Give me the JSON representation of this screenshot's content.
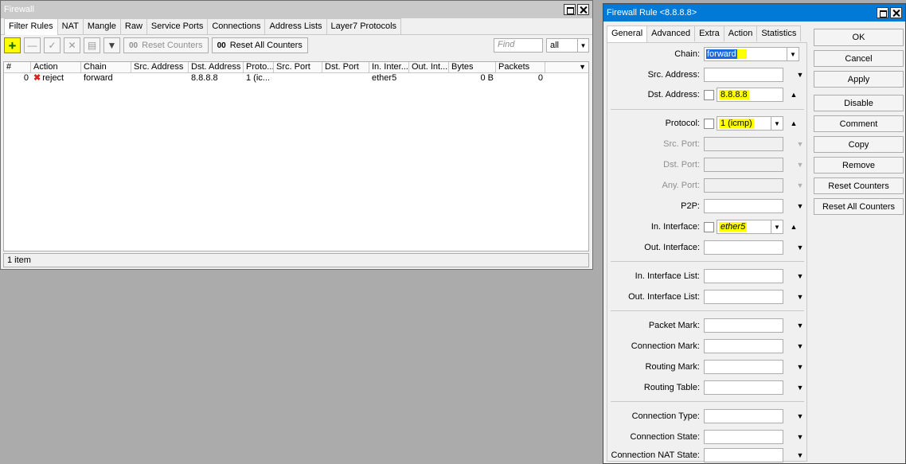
{
  "firewall": {
    "title": "Firewall",
    "tabs": [
      "Filter Rules",
      "NAT",
      "Mangle",
      "Raw",
      "Service Ports",
      "Connections",
      "Address Lists",
      "Layer7 Protocols"
    ],
    "toolbar": {
      "reset_counters": "Reset Counters",
      "reset_all_counters": "Reset All Counters",
      "counter_glyph": "00",
      "find_placeholder": "Find",
      "filter_value": "all"
    },
    "columns": [
      "#",
      "Action",
      "Chain",
      "Src. Address",
      "Dst. Address",
      "Proto...",
      "Src. Port",
      "Dst. Port",
      "In. Inter...",
      "Out. Int...",
      "Bytes",
      "Packets"
    ],
    "rows": [
      {
        "num": "0",
        "action": "reject",
        "chain": "forward",
        "src_address": "",
        "dst_address": "8.8.8.8",
        "protocol": "1 (ic...",
        "src_port": "",
        "dst_port": "",
        "in_interface": "ether5",
        "out_interface": "",
        "bytes": "0 B",
        "packets": "0"
      }
    ],
    "status": "1 item"
  },
  "rule": {
    "title": "Firewall Rule <8.8.8.8>",
    "tabs": [
      "General",
      "Advanced",
      "Extra",
      "Action",
      "Statistics"
    ],
    "fields": {
      "chain": {
        "label": "Chain:",
        "value": "forward"
      },
      "src_address": {
        "label": "Src. Address:"
      },
      "dst_address": {
        "label": "Dst. Address:",
        "value": "8.8.8.8"
      },
      "protocol": {
        "label": "Protocol:",
        "value": "1 (icmp)"
      },
      "src_port": {
        "label": "Src. Port:"
      },
      "dst_port": {
        "label": "Dst. Port:"
      },
      "any_port": {
        "label": "Any. Port:"
      },
      "p2p": {
        "label": "P2P:"
      },
      "in_interface": {
        "label": "In. Interface:",
        "value": "ether5"
      },
      "out_interface": {
        "label": "Out. Interface:"
      },
      "in_interface_list": {
        "label": "In. Interface List:"
      },
      "out_interface_list": {
        "label": "Out. Interface List:"
      },
      "packet_mark": {
        "label": "Packet Mark:"
      },
      "connection_mark": {
        "label": "Connection Mark:"
      },
      "routing_mark": {
        "label": "Routing Mark:"
      },
      "routing_table": {
        "label": "Routing Table:"
      },
      "connection_type": {
        "label": "Connection Type:"
      },
      "connection_state": {
        "label": "Connection State:"
      },
      "connection_nat_state": {
        "label": "Connection NAT State:"
      }
    },
    "buttons": {
      "ok": "OK",
      "cancel": "Cancel",
      "apply": "Apply",
      "disable": "Disable",
      "comment": "Comment",
      "copy": "Copy",
      "remove": "Remove",
      "reset_counters": "Reset Counters",
      "reset_all_counters": "Reset All Counters"
    }
  },
  "colors": {
    "highlight": "#ffff00",
    "titlebar_active": "#0079d7",
    "titlebar_inactive": "#c9c9c9",
    "reject_icon": "#e02020"
  }
}
